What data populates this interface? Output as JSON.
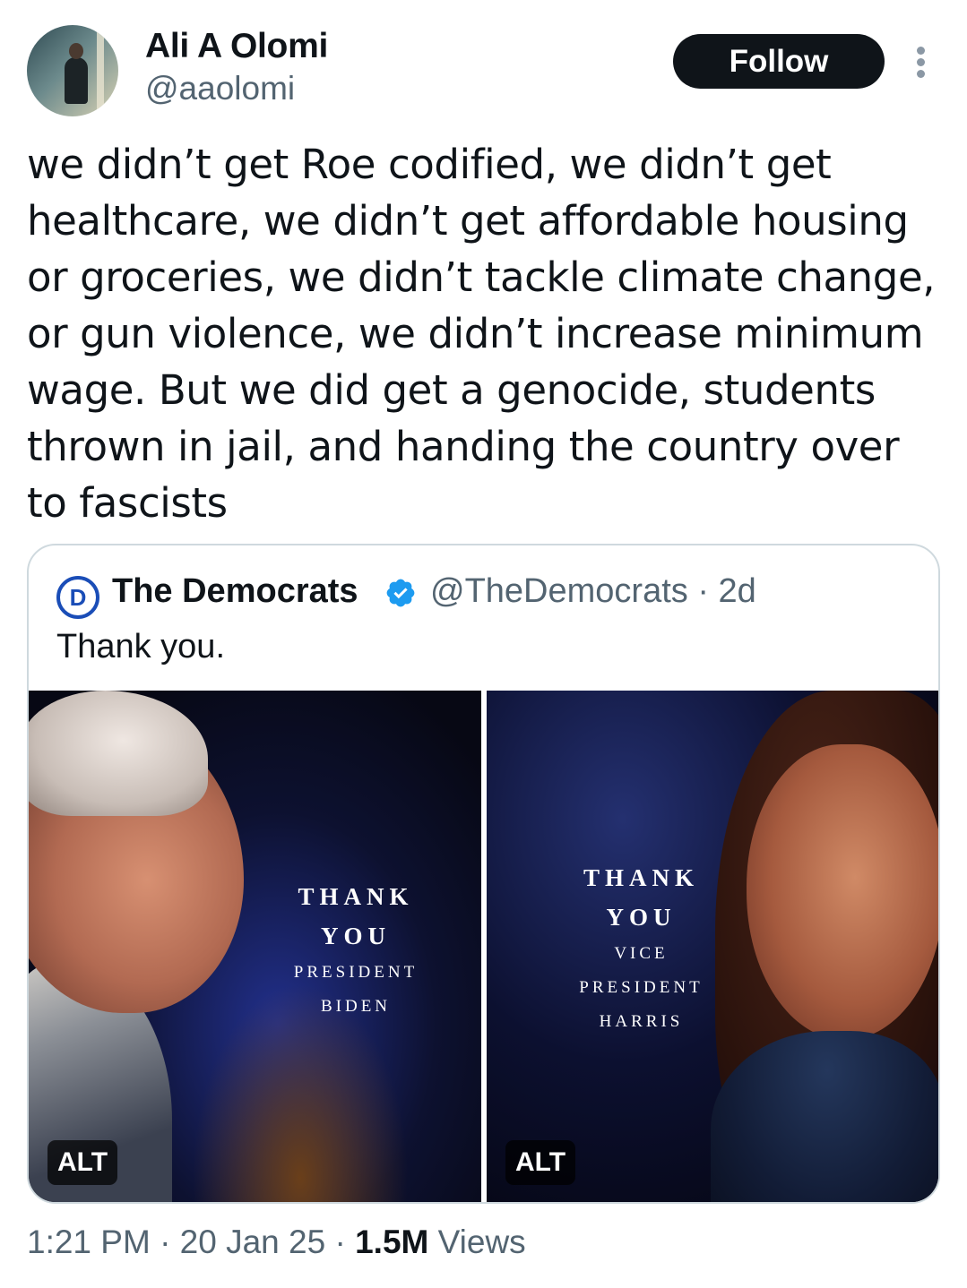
{
  "author": {
    "name": "Ali A Olomi",
    "handle": "@aaolomi"
  },
  "actions": {
    "follow_label": "Follow"
  },
  "tweet": {
    "text": "we didn’t get Roe codified, we didn’t get healthcare, we didn’t get affordable housing or groceries, we didn’t tackle climate change, or gun violence, we didn’t increase minimum wage. But we did get a genocide, students thrown in jail, and handing the country over to fascists"
  },
  "quoted": {
    "logo_letter": "D",
    "name": "The Democrats",
    "handle_time": "@TheDemocrats · 2d",
    "text": "Thank you.",
    "media": [
      {
        "line1": "THANK",
        "line2": "YOU",
        "line3": "PRESIDENT",
        "line4": "BIDEN",
        "alt": "ALT"
      },
      {
        "line1": "THANK",
        "line2": "YOU",
        "line3": "VICE",
        "line4": "PRESIDENT",
        "line5": "HARRIS",
        "alt": "ALT"
      }
    ]
  },
  "footer": {
    "time_date": "1:21 PM · 20 Jan 25 · ",
    "views_count": "1.5M",
    "views_label": " Views"
  },
  "colors": {
    "verified": "#1d9bf0",
    "follow_bg": "#0f1419",
    "secondary_text": "#536471",
    "democrats_blue": "#1a4db7"
  },
  "icons": [
    "more-icon",
    "verified-badge-icon",
    "democrats-logo-icon"
  ]
}
